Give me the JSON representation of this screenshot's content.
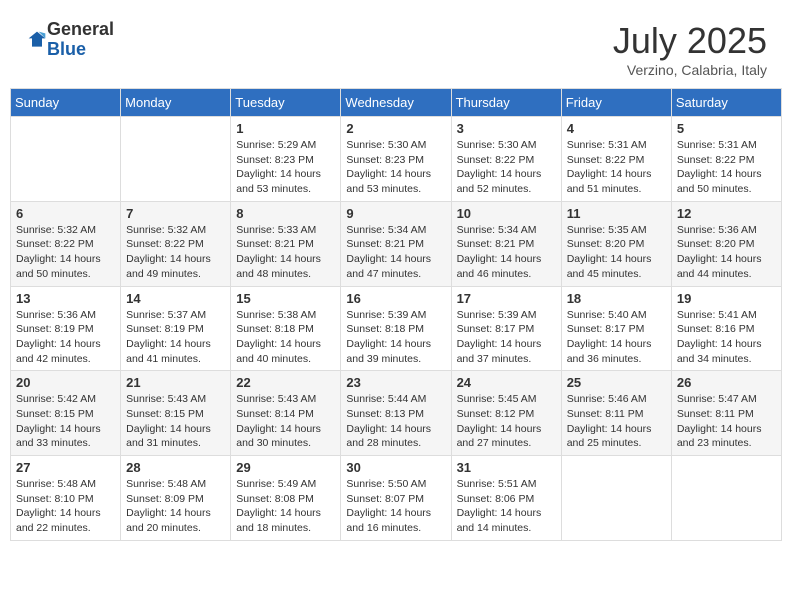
{
  "header": {
    "logo_general": "General",
    "logo_blue": "Blue",
    "title": "July 2025",
    "location": "Verzino, Calabria, Italy"
  },
  "days_of_week": [
    "Sunday",
    "Monday",
    "Tuesday",
    "Wednesday",
    "Thursday",
    "Friday",
    "Saturday"
  ],
  "weeks": [
    [
      {
        "day": "",
        "info": ""
      },
      {
        "day": "",
        "info": ""
      },
      {
        "day": "1",
        "info": "Sunrise: 5:29 AM\nSunset: 8:23 PM\nDaylight: 14 hours and 53 minutes."
      },
      {
        "day": "2",
        "info": "Sunrise: 5:30 AM\nSunset: 8:23 PM\nDaylight: 14 hours and 53 minutes."
      },
      {
        "day": "3",
        "info": "Sunrise: 5:30 AM\nSunset: 8:22 PM\nDaylight: 14 hours and 52 minutes."
      },
      {
        "day": "4",
        "info": "Sunrise: 5:31 AM\nSunset: 8:22 PM\nDaylight: 14 hours and 51 minutes."
      },
      {
        "day": "5",
        "info": "Sunrise: 5:31 AM\nSunset: 8:22 PM\nDaylight: 14 hours and 50 minutes."
      }
    ],
    [
      {
        "day": "6",
        "info": "Sunrise: 5:32 AM\nSunset: 8:22 PM\nDaylight: 14 hours and 50 minutes."
      },
      {
        "day": "7",
        "info": "Sunrise: 5:32 AM\nSunset: 8:22 PM\nDaylight: 14 hours and 49 minutes."
      },
      {
        "day": "8",
        "info": "Sunrise: 5:33 AM\nSunset: 8:21 PM\nDaylight: 14 hours and 48 minutes."
      },
      {
        "day": "9",
        "info": "Sunrise: 5:34 AM\nSunset: 8:21 PM\nDaylight: 14 hours and 47 minutes."
      },
      {
        "day": "10",
        "info": "Sunrise: 5:34 AM\nSunset: 8:21 PM\nDaylight: 14 hours and 46 minutes."
      },
      {
        "day": "11",
        "info": "Sunrise: 5:35 AM\nSunset: 8:20 PM\nDaylight: 14 hours and 45 minutes."
      },
      {
        "day": "12",
        "info": "Sunrise: 5:36 AM\nSunset: 8:20 PM\nDaylight: 14 hours and 44 minutes."
      }
    ],
    [
      {
        "day": "13",
        "info": "Sunrise: 5:36 AM\nSunset: 8:19 PM\nDaylight: 14 hours and 42 minutes."
      },
      {
        "day": "14",
        "info": "Sunrise: 5:37 AM\nSunset: 8:19 PM\nDaylight: 14 hours and 41 minutes."
      },
      {
        "day": "15",
        "info": "Sunrise: 5:38 AM\nSunset: 8:18 PM\nDaylight: 14 hours and 40 minutes."
      },
      {
        "day": "16",
        "info": "Sunrise: 5:39 AM\nSunset: 8:18 PM\nDaylight: 14 hours and 39 minutes."
      },
      {
        "day": "17",
        "info": "Sunrise: 5:39 AM\nSunset: 8:17 PM\nDaylight: 14 hours and 37 minutes."
      },
      {
        "day": "18",
        "info": "Sunrise: 5:40 AM\nSunset: 8:17 PM\nDaylight: 14 hours and 36 minutes."
      },
      {
        "day": "19",
        "info": "Sunrise: 5:41 AM\nSunset: 8:16 PM\nDaylight: 14 hours and 34 minutes."
      }
    ],
    [
      {
        "day": "20",
        "info": "Sunrise: 5:42 AM\nSunset: 8:15 PM\nDaylight: 14 hours and 33 minutes."
      },
      {
        "day": "21",
        "info": "Sunrise: 5:43 AM\nSunset: 8:15 PM\nDaylight: 14 hours and 31 minutes."
      },
      {
        "day": "22",
        "info": "Sunrise: 5:43 AM\nSunset: 8:14 PM\nDaylight: 14 hours and 30 minutes."
      },
      {
        "day": "23",
        "info": "Sunrise: 5:44 AM\nSunset: 8:13 PM\nDaylight: 14 hours and 28 minutes."
      },
      {
        "day": "24",
        "info": "Sunrise: 5:45 AM\nSunset: 8:12 PM\nDaylight: 14 hours and 27 minutes."
      },
      {
        "day": "25",
        "info": "Sunrise: 5:46 AM\nSunset: 8:11 PM\nDaylight: 14 hours and 25 minutes."
      },
      {
        "day": "26",
        "info": "Sunrise: 5:47 AM\nSunset: 8:11 PM\nDaylight: 14 hours and 23 minutes."
      }
    ],
    [
      {
        "day": "27",
        "info": "Sunrise: 5:48 AM\nSunset: 8:10 PM\nDaylight: 14 hours and 22 minutes."
      },
      {
        "day": "28",
        "info": "Sunrise: 5:48 AM\nSunset: 8:09 PM\nDaylight: 14 hours and 20 minutes."
      },
      {
        "day": "29",
        "info": "Sunrise: 5:49 AM\nSunset: 8:08 PM\nDaylight: 14 hours and 18 minutes."
      },
      {
        "day": "30",
        "info": "Sunrise: 5:50 AM\nSunset: 8:07 PM\nDaylight: 14 hours and 16 minutes."
      },
      {
        "day": "31",
        "info": "Sunrise: 5:51 AM\nSunset: 8:06 PM\nDaylight: 14 hours and 14 minutes."
      },
      {
        "day": "",
        "info": ""
      },
      {
        "day": "",
        "info": ""
      }
    ]
  ]
}
